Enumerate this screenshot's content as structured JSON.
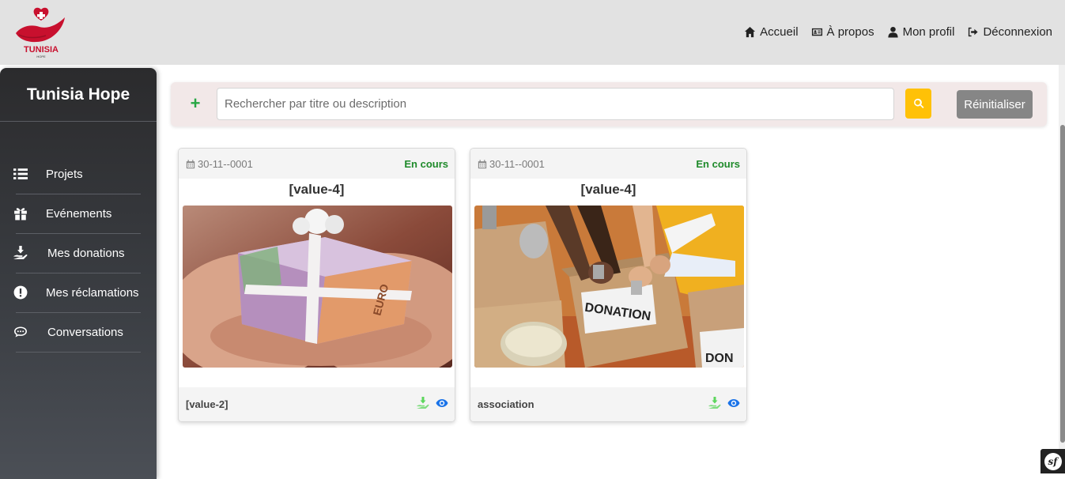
{
  "app": {
    "logo_text": "TUNISIA",
    "logo_subtext": "HOPE"
  },
  "nav": {
    "items": [
      {
        "label": "Accueil",
        "icon": "home-icon"
      },
      {
        "label": "À propos",
        "icon": "id-card-icon"
      },
      {
        "label": "Mon profil",
        "icon": "user-icon"
      },
      {
        "label": "Déconnexion",
        "icon": "sign-out-icon"
      }
    ]
  },
  "sidebar": {
    "title": "Tunisia Hope",
    "items": [
      {
        "label": "Projets",
        "icon": "list-icon"
      },
      {
        "label": "Evénements",
        "icon": "gift-icon"
      },
      {
        "label": "Mes donations",
        "icon": "hand-holding-icon"
      },
      {
        "label": "Mes réclamations",
        "icon": "exclamation-circle-icon"
      },
      {
        "label": "Conversations",
        "icon": "chat-icon"
      }
    ]
  },
  "search": {
    "add_label": "+",
    "placeholder": "Rechercher par titre ou description",
    "value": "",
    "reset_label": "Réinitialiser"
  },
  "cards": [
    {
      "date": "30-11--0001",
      "status": "En cours",
      "title": "[value-4]",
      "image": "gift-box-money-photo",
      "owner": "[value-2]"
    },
    {
      "date": "30-11--0001",
      "status": "En cours",
      "title": "[value-4]",
      "image": "donation-box-photo",
      "owner": "association"
    }
  ],
  "colors": {
    "topbar": "#e2e2e2",
    "sidebar": "#2b2b2d",
    "accent_yellow": "#ffc107",
    "status_green": "#1e8a2a",
    "brand_red": "#c8102e"
  }
}
